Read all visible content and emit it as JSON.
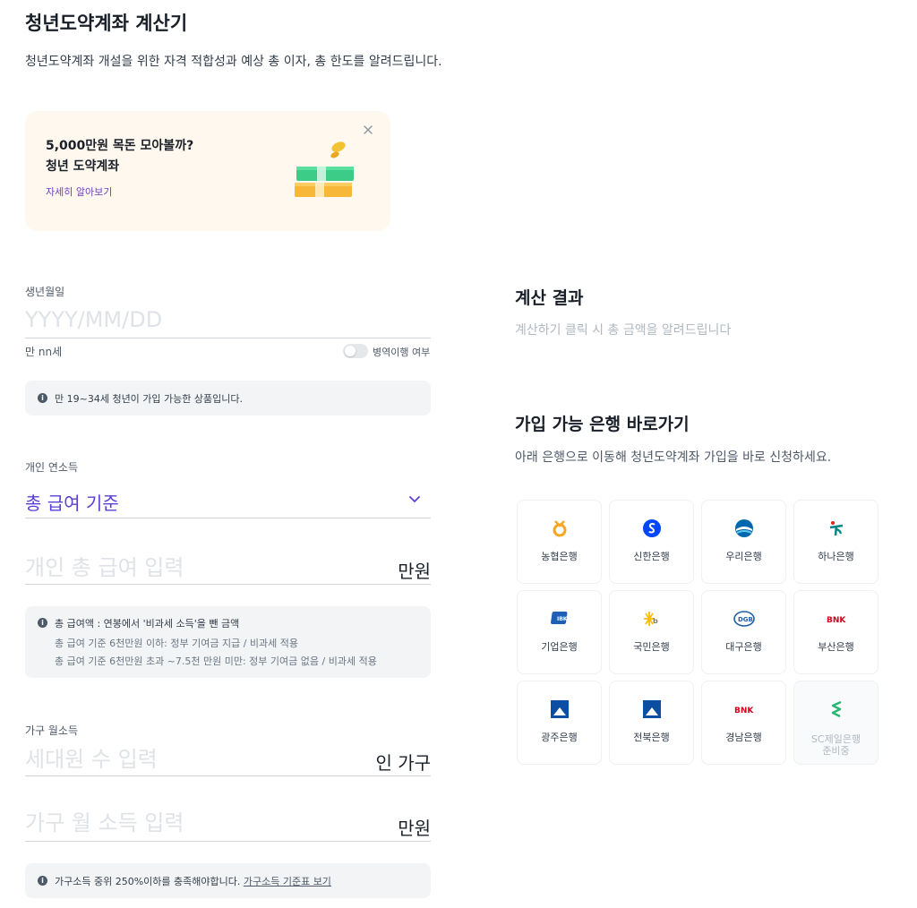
{
  "page": {
    "title": "청년도약계좌 계산기",
    "subtitle": "청년도약계좌 개설을 위한 자격 적합성과 예상 총 이자, 총 한도를 알려드립니다."
  },
  "promo": {
    "line1": "5,000만원 목돈 모아볼까?",
    "line2": "청년 도약계좌",
    "link": "자세히 알아보기"
  },
  "birth": {
    "label": "생년월일",
    "placeholder": "YYYY/MM/DD",
    "age_text": "만 nn세",
    "military_label": "병역이행 여부",
    "info": "만 19~34세 청년이 가입 가능한 상품입니다."
  },
  "income": {
    "label": "개인 연소득",
    "select_value": "총 급여 기준",
    "input_placeholder": "개인 총 급여 입력",
    "unit": "만원",
    "info_title": "총 급여액 : 연봉에서 '비과세 소득'을 뺀 금액",
    "info_line1": "총 급여 기준 6천만원 이하: 정부 기여금 지급 / 비과세 적용",
    "info_line2": "총 급여 기준 6천만원 초과 ~7.5천 만원 미만: 정부 기여금 없음 / 비과세 적용"
  },
  "household": {
    "label": "가구 월소득",
    "members_placeholder": "세대원 수 입력",
    "members_unit": "인 가구",
    "income_placeholder": "가구 월 소득 입력",
    "income_unit": "만원",
    "info": "가구소득 중위 250%이하를 충족해야합니다.",
    "info_link": "가구소득 기준표 보기"
  },
  "result": {
    "title": "계산 결과",
    "desc": "계산하기 클릭 시 총 금액을 알려드립니다"
  },
  "banks": {
    "title": "가입 가능 은행 바로가기",
    "desc": "아래 은행으로 이동해 청년도약계좌 가입을 바로 신청하세요.",
    "items": [
      {
        "name": "농협은행",
        "icon": "nh-logo-icon",
        "color": "#f5a623"
      },
      {
        "name": "신한은행",
        "icon": "shinhan-logo-icon",
        "color": "#0046ff"
      },
      {
        "name": "우리은행",
        "icon": "woori-logo-icon",
        "color": "#0067ac"
      },
      {
        "name": "하나은행",
        "icon": "hana-logo-icon",
        "color": "#008485"
      },
      {
        "name": "기업은행",
        "icon": "ibk-logo-icon",
        "color": "#1f5fb7"
      },
      {
        "name": "국민은행",
        "icon": "kb-logo-icon",
        "color": "#ffbc00"
      },
      {
        "name": "대구은행",
        "icon": "dgb-logo-icon",
        "color": "#1e5fa8"
      },
      {
        "name": "부산은행",
        "icon": "bnk-logo-icon",
        "color": "#d6001c"
      },
      {
        "name": "광주은행",
        "icon": "kjb-logo-icon",
        "color": "#0b4ea2"
      },
      {
        "name": "전북은행",
        "icon": "jb-logo-icon",
        "color": "#0b4ea2"
      },
      {
        "name": "경남은행",
        "icon": "bnk-logo-icon",
        "color": "#d6001c"
      },
      {
        "name": "SC제일은행",
        "sub": "준비중",
        "icon": "sc-logo-icon",
        "color": "#2bb673"
      }
    ]
  }
}
